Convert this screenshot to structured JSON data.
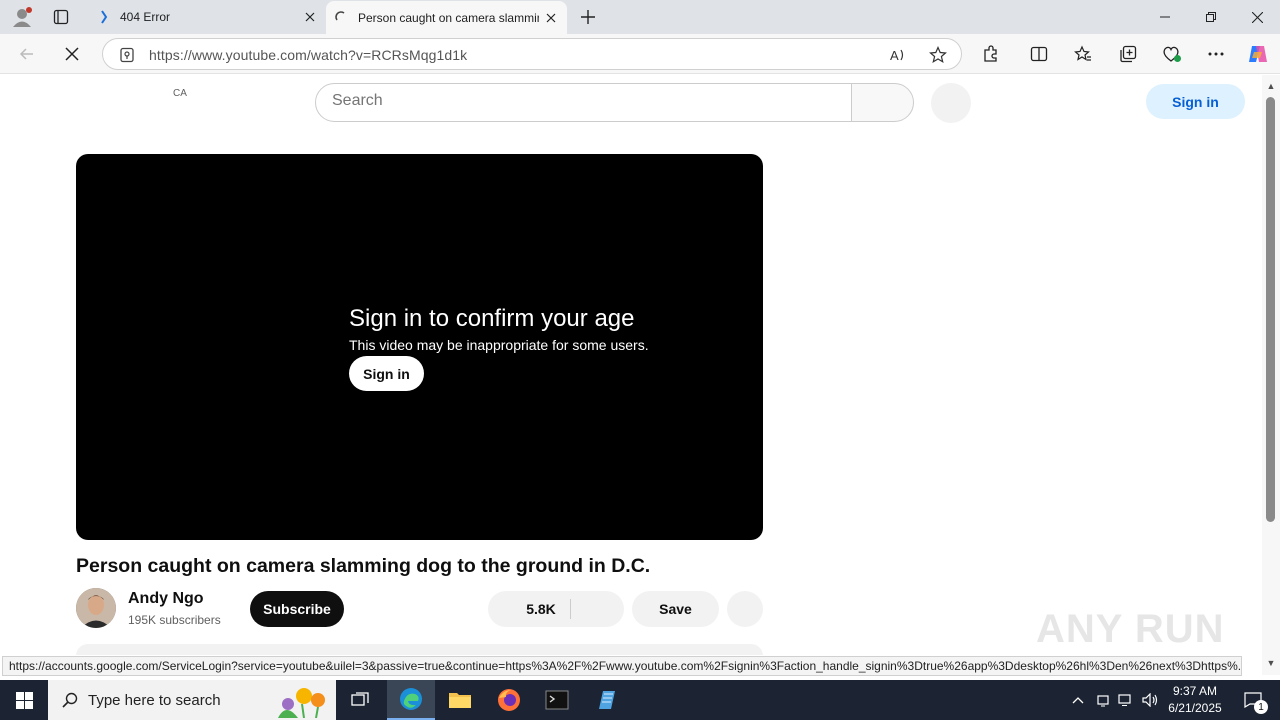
{
  "browser": {
    "tabs": [
      {
        "title": "404 Error",
        "active": false
      },
      {
        "title": "Person caught on camera slamming dog to the ground in D.C.",
        "active": true
      }
    ],
    "url": "https://www.youtube.com/watch?v=RCRsMqg1d1k",
    "status_url": "https://accounts.google.com/ServiceLogin?service=youtube&uilel=3&passive=true&continue=https%3A%2F%2Fwww.youtube.com%2Fsignin%3Faction_handle_signin%3Dtrue%26app%3Ddesktop%26hl%3Den%26next%3Dhttps%..."
  },
  "youtube": {
    "country_code": "CA",
    "search_placeholder": "Search",
    "sign_in_label": "Sign in",
    "age_gate": {
      "title": "Sign in to confirm your age",
      "subtitle": "This video may be inappropriate for some users.",
      "button": "Sign in"
    },
    "video": {
      "title": "Person caught on camera slamming dog to the ground in D.C.",
      "channel": "Andy Ngo",
      "subscribers": "195K subscribers",
      "subscribe_label": "Subscribe",
      "likes": "5.8K",
      "save_label": "Save"
    }
  },
  "watermark": "ANY RUN",
  "taskbar": {
    "search_placeholder": "Type here to search",
    "time": "9:37 AM",
    "date": "6/21/2025",
    "notification_count": "1"
  },
  "colors": {
    "accent_blue": "#065fd4",
    "signin_bg": "#def1ff",
    "player_bg": "#000000",
    "taskbar_bg": "#1c2433"
  }
}
